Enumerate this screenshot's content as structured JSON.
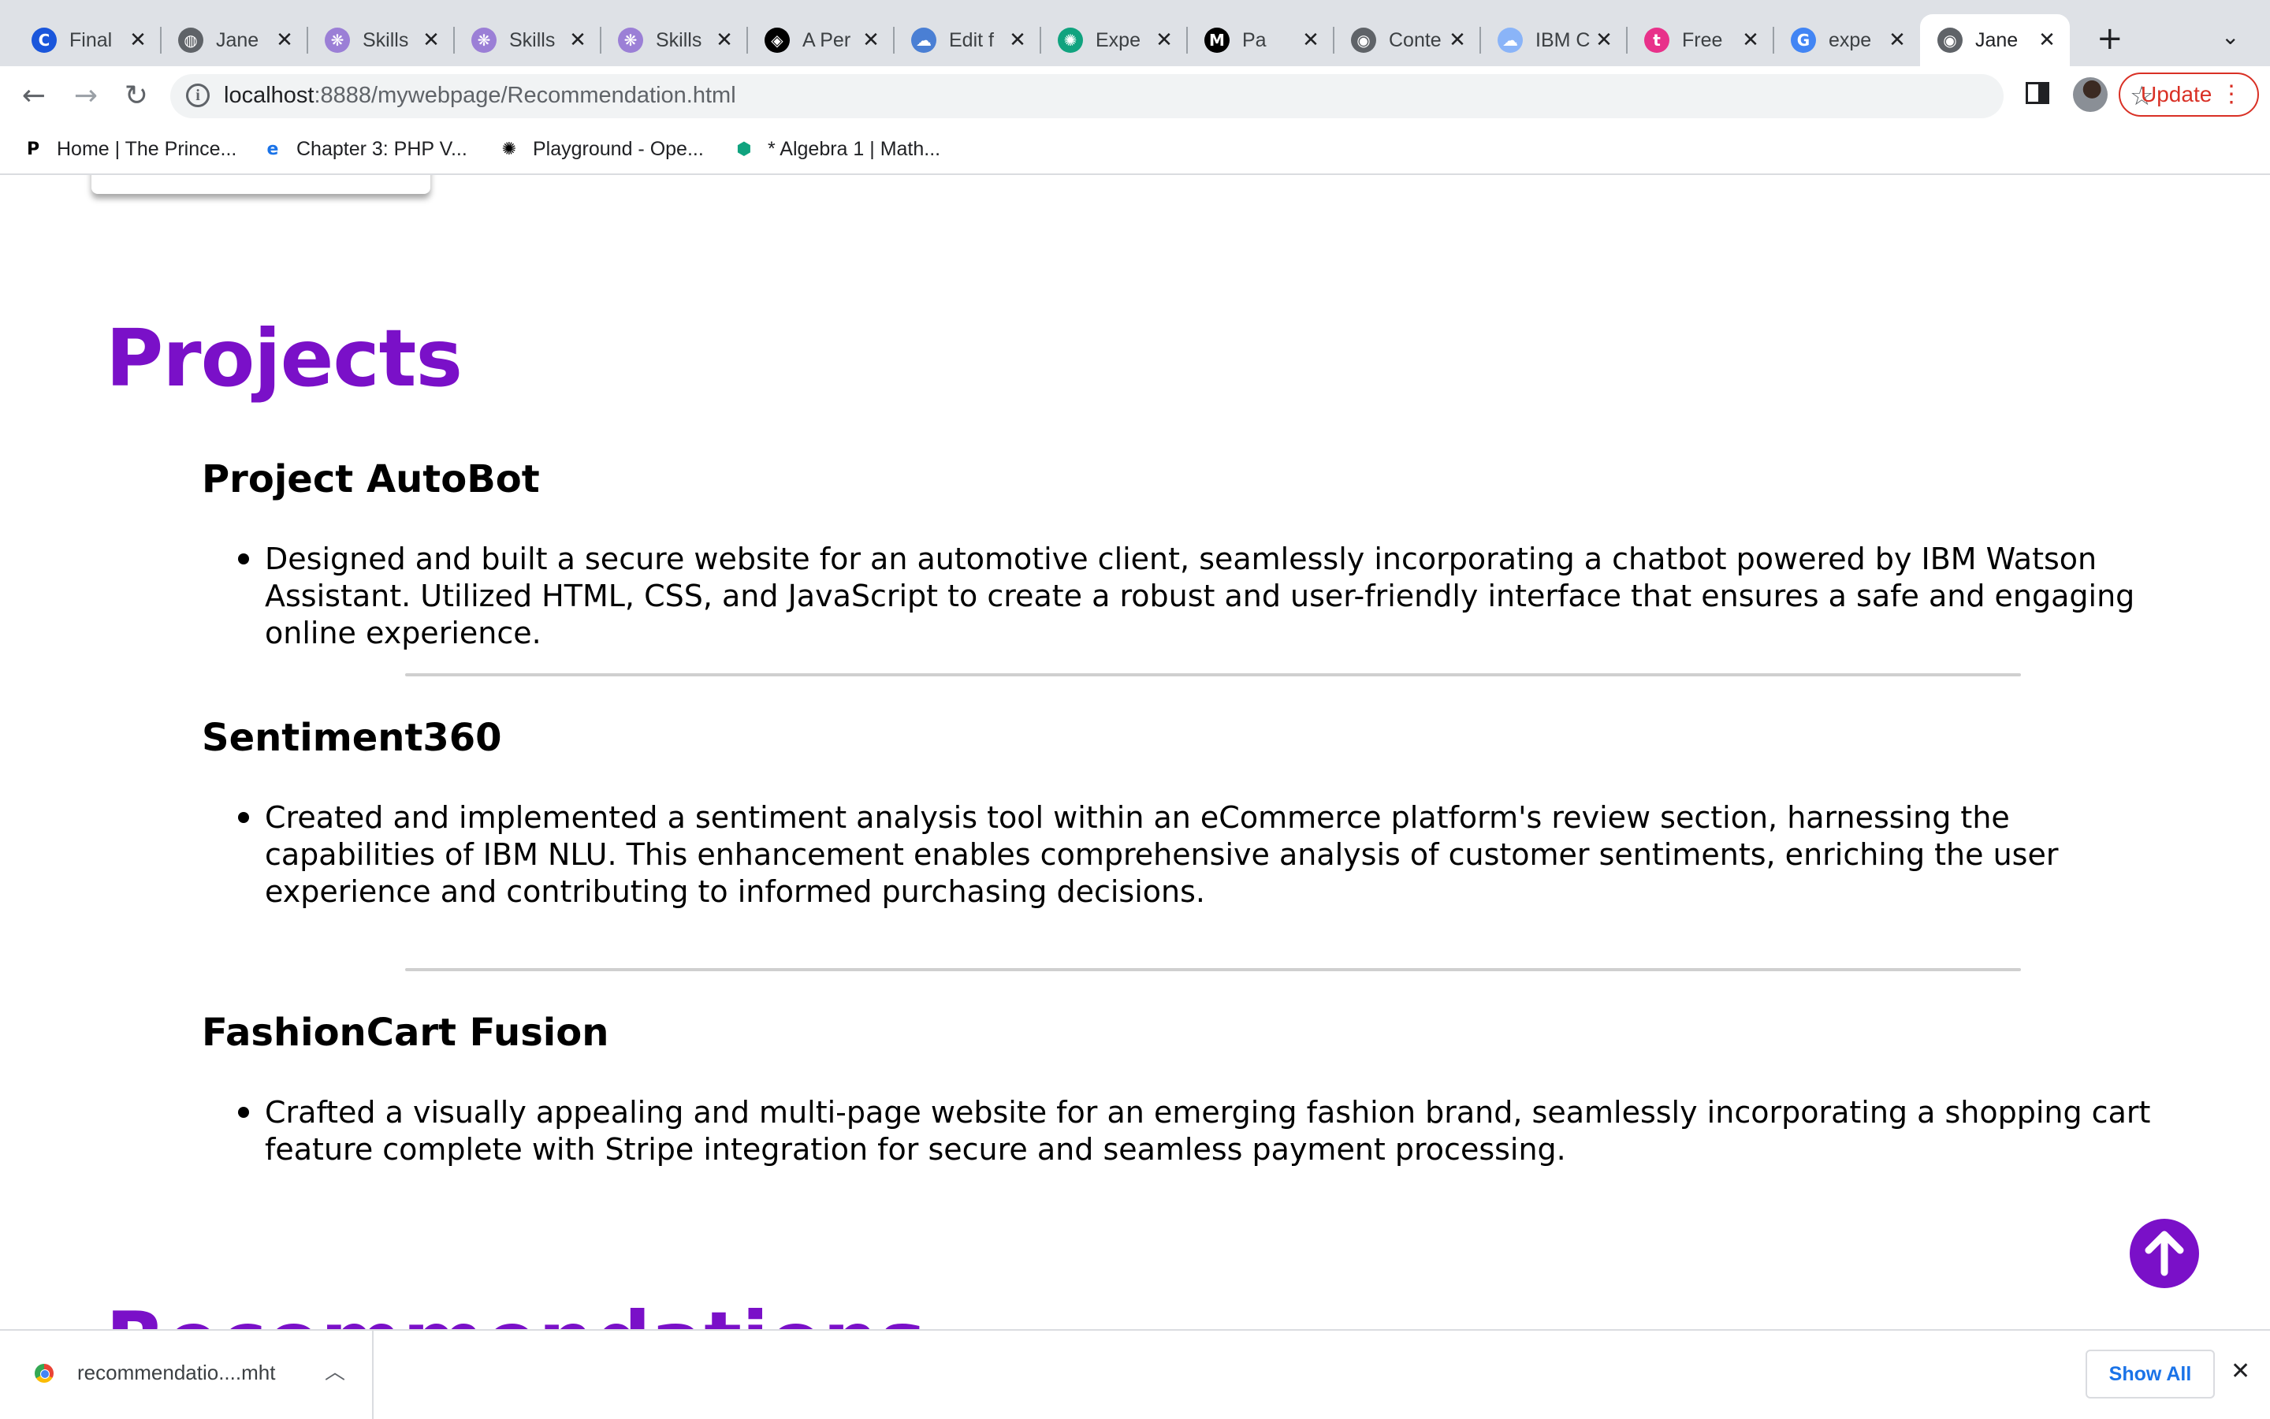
{
  "browser": {
    "tabs": [
      {
        "title": "Final",
        "icon": "c-logo-icon",
        "icon_color": "#1a56db",
        "icon_glyph": "C"
      },
      {
        "title": "Jane",
        "icon": "globe-icon",
        "icon_color": "#5f6368",
        "icon_glyph": "◍"
      },
      {
        "title": "Skills",
        "icon": "skills-network-icon",
        "icon_color": "#9b7fd6",
        "icon_glyph": "❋"
      },
      {
        "title": "Skills",
        "icon": "skills-network-icon",
        "icon_color": "#9b7fd6",
        "icon_glyph": "❋"
      },
      {
        "title": "Skills",
        "icon": "skills-network-icon",
        "icon_color": "#9b7fd6",
        "icon_glyph": "❋"
      },
      {
        "title": "A Per",
        "icon": "codepen-icon",
        "icon_color": "#000000",
        "icon_glyph": "◈"
      },
      {
        "title": "Edit f",
        "icon": "cloud-icon",
        "icon_color": "#4a7fd4",
        "icon_glyph": "☁"
      },
      {
        "title": "Expe",
        "icon": "openai-icon",
        "icon_color": "#10a37f",
        "icon_glyph": "✺"
      },
      {
        "title": "Pa",
        "icon": "medium-icon",
        "icon_color": "#000000",
        "icon_glyph": "M"
      },
      {
        "title": "Conte",
        "icon": "github-icon",
        "icon_color": "#5f6368",
        "icon_glyph": "◉"
      },
      {
        "title": "IBM C",
        "icon": "ibm-cloud-icon",
        "icon_color": "#8ab4f8",
        "icon_glyph": "☁"
      },
      {
        "title": "Free",
        "icon": "letter-t-icon",
        "icon_color": "#e8318a",
        "icon_glyph": "t"
      },
      {
        "title": "expe",
        "icon": "google-icon",
        "icon_color": "#4285f4",
        "icon_glyph": "G"
      },
      {
        "title": "Jane",
        "icon": "github-icon",
        "icon_color": "#5f6368",
        "icon_glyph": "◉"
      }
    ],
    "active_tab_index": 13,
    "new_tab_glyph": "+",
    "tab_menu_glyph": "⌄",
    "close_glyph": "✕",
    "back_glyph": "←",
    "forward_glyph": "→",
    "reload_glyph": "↻",
    "url_host": "localhost",
    "url_rest": ":8888/mywebpage/Recommendation.html",
    "update_label": "Update",
    "bookmarks": [
      {
        "label": "Home | The Prince...",
        "icon": "princeton-review-icon",
        "glyph": "P"
      },
      {
        "label": "Chapter 3: PHP V...",
        "icon": "edge-icon",
        "glyph": "e"
      },
      {
        "label": "Playground - Ope...",
        "icon": "openai-icon",
        "glyph": "✺"
      },
      {
        "label": "* Algebra 1 | Math...",
        "icon": "khan-academy-icon",
        "glyph": "⬢"
      }
    ]
  },
  "content": {
    "section_title": "Projects",
    "projects": [
      {
        "title": "Project AutoBot",
        "description": "Designed and built a secure website for an automotive client, seamlessly incorporating a chatbot powered by IBM Watson Assistant. Utilized HTML, CSS, and JavaScript to create a robust and user-friendly interface that ensures a safe and engaging online experience."
      },
      {
        "title": "Sentiment360",
        "description": "Created and implemented a sentiment analysis tool within an eCommerce platform's review section, harnessing the capabilities of IBM NLU. This enhancement enables comprehensive analysis of customer sentiments, enriching the user experience and contributing to informed purchasing decisions."
      },
      {
        "title": "FashionCart Fusion",
        "description": "Crafted a visually appealing and multi-page website for an emerging fashion brand, seamlessly incorporating a shopping cart feature complete with Stripe integration for secure and seamless payment processing."
      }
    ],
    "next_section_title": "Recommendations",
    "accent_color": "#7a10c8"
  },
  "downloads": {
    "file_name": "recommendatio....mht",
    "show_all_label": "Show All"
  }
}
